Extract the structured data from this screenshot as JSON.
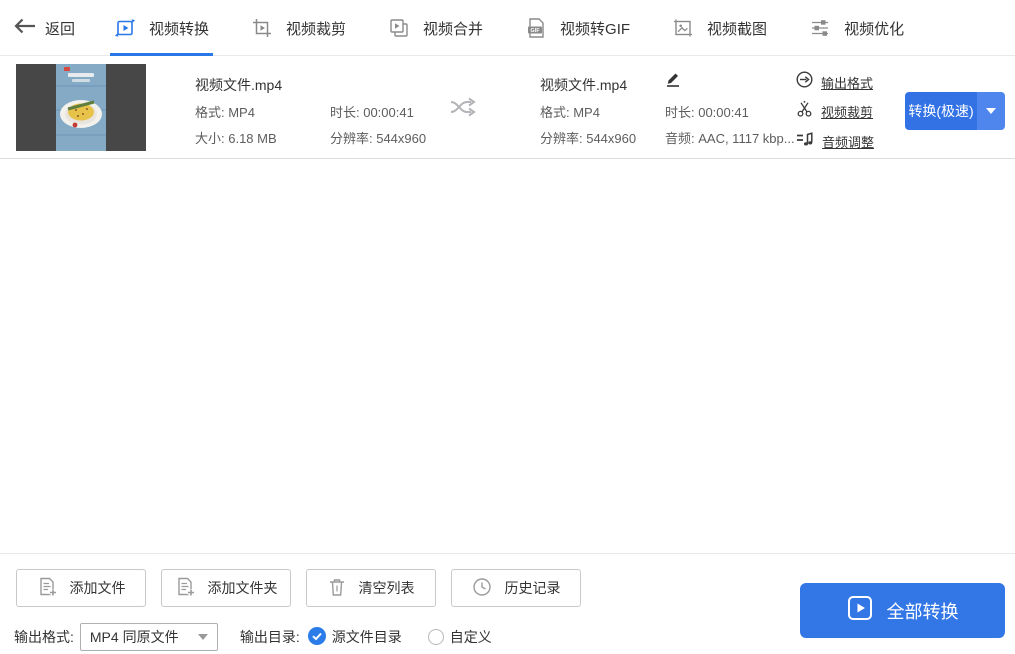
{
  "nav": {
    "back_label": "返回",
    "tabs": [
      {
        "label": "视频转换",
        "active": true
      },
      {
        "label": "视频裁剪",
        "active": false
      },
      {
        "label": "视频合并",
        "active": false
      },
      {
        "label": "视频转GIF",
        "active": false
      },
      {
        "label": "视频截图",
        "active": false
      },
      {
        "label": "视频优化",
        "active": false
      }
    ]
  },
  "file_row": {
    "source": {
      "filename": "视频文件.mp4",
      "format": "格式: MP4",
      "duration": "时长: 00:00:41",
      "size": "大小: 6.18 MB",
      "resolution": "分辨率: 544x960"
    },
    "output": {
      "filename": "视频文件.mp4",
      "format": "格式: MP4",
      "duration": "时长: 00:00:41",
      "resolution": "分辨率: 544x960",
      "audio": "音频: AAC, 1117 kbp..."
    },
    "actions": [
      {
        "label": "输出格式"
      },
      {
        "label": "视频裁剪"
      },
      {
        "label": "音频调整"
      }
    ],
    "convert_button_label": "转换(极速)"
  },
  "toolbar": {
    "buttons": [
      {
        "label": "添加文件"
      },
      {
        "label": "添加文件夹"
      },
      {
        "label": "清空列表"
      },
      {
        "label": "历史记录"
      }
    ]
  },
  "output_bar": {
    "format_label": "输出格式:",
    "format_value": "MP4 同原文件",
    "dir_label": "输出目录:",
    "dir_options": [
      {
        "label": "源文件目录",
        "selected": true
      },
      {
        "label": "自定义",
        "selected": false
      }
    ],
    "convert_all_label": "全部转换"
  },
  "icons": {
    "back-arrow-icon": "←",
    "video-convert-icon": "play-square-rotate",
    "video-crop-tab-icon": "crop-play",
    "video-merge-icon": "stacked-squares-play",
    "video-gif-icon": "gif-file",
    "video-screenshot-icon": "image-frame",
    "video-optimize-icon": "sliders",
    "shuffle-icon": "crossed-arrows",
    "edit-icon": "pencil",
    "output-format-icon": "circle-arrow",
    "video-crop-action-icon": "scissors",
    "audio-adjust-icon": "music-note-bars",
    "dropdown-arrow-icon": "▼",
    "add-file-icon": "document-plus",
    "add-folder-icon": "document-plus",
    "clear-list-icon": "trash",
    "history-icon": "clock",
    "convert-all-icon": "play-square",
    "radio-checked-icon": "check-circle"
  },
  "colors": {
    "accent_blue": "#2878e8",
    "convert_button_blue": "#3372e4",
    "convert_all_blue": "#3377e6",
    "link_text": "#333333",
    "meta_text": "#5d5d5d"
  }
}
